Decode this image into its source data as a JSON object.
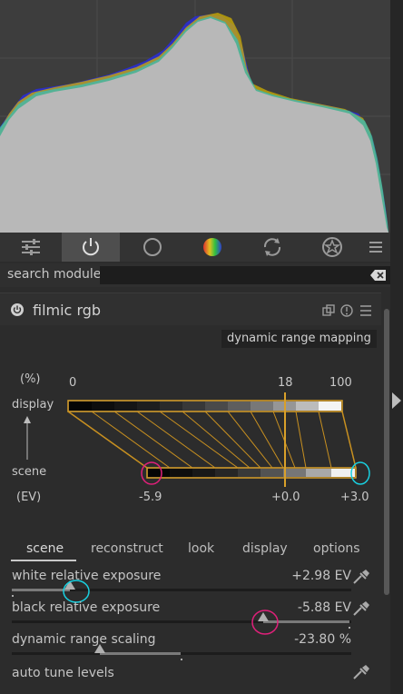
{
  "search": {
    "label": "search module",
    "value": ""
  },
  "module": {
    "name": "filmic rgb"
  },
  "graph": {
    "mode_label": "dynamic range mapping",
    "pct_label": "(%)",
    "display_label": "display",
    "scene_label": "scene",
    "ev_label": "(EV)",
    "display_ticks": [
      "0",
      "18",
      "100"
    ],
    "scene_ticks": [
      "-5.9",
      "+0.0",
      "+3.0"
    ]
  },
  "tabs": [
    "scene",
    "reconstruct",
    "look",
    "display",
    "options"
  ],
  "active_tab": "scene",
  "sliders": [
    {
      "name": "white relative exposure",
      "value": "+2.98 EV",
      "level": 0.17
    },
    {
      "name": "black relative exposure",
      "value": "-5.88 EV",
      "level": 0.74
    },
    {
      "name": "dynamic range scaling",
      "value": "-23.80 %",
      "level": 0.26
    }
  ],
  "auto_tune": {
    "label": "auto tune levels"
  },
  "icons": [
    "sliders-icon",
    "power-icon",
    "circle-icon",
    "color-wheel-icon",
    "refresh-icon",
    "favorites-icon",
    "menu-icon",
    "clear-icon",
    "eyedropper-icon"
  ],
  "colors": {
    "accent_orange": "#d9a02a",
    "marker_cyan": "#19d0e0",
    "marker_magenta": "#e0207a"
  }
}
